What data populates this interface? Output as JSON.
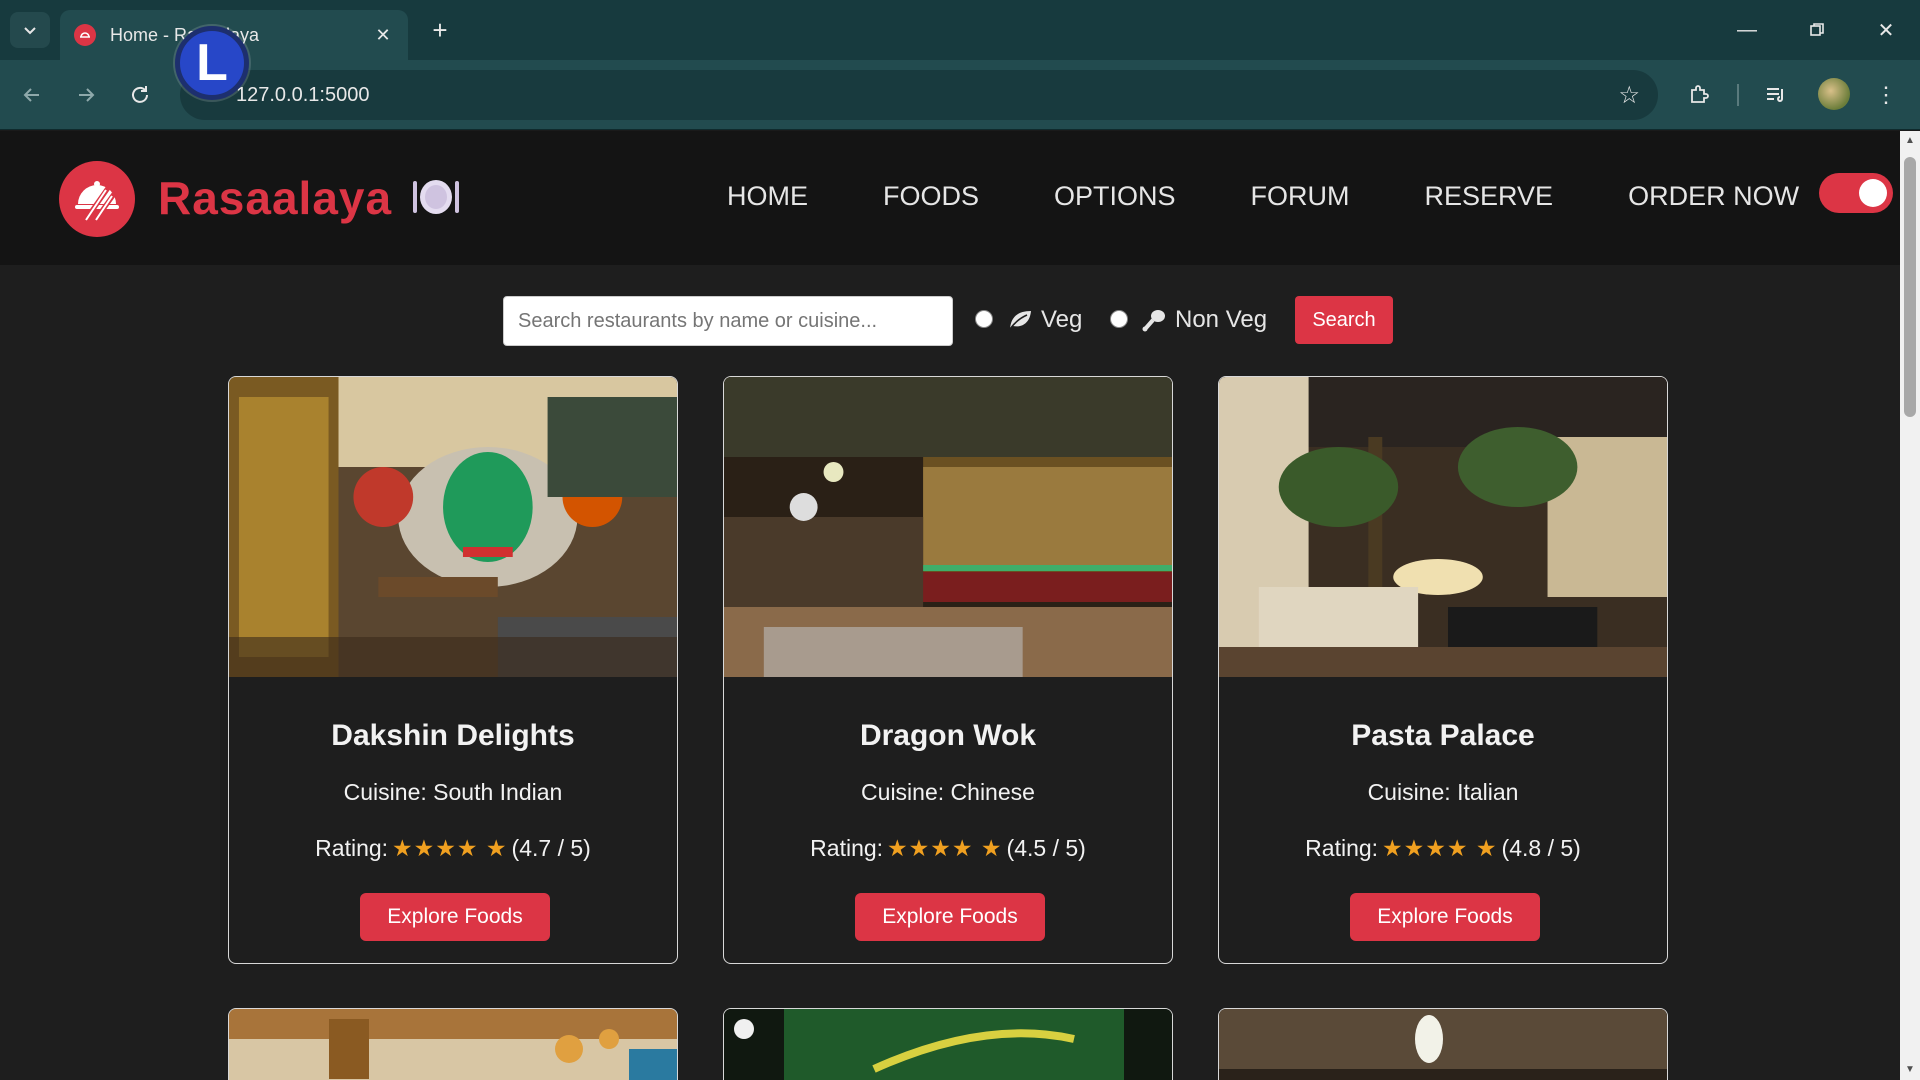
{
  "browser": {
    "tab_title": "Home - Rasaalaya",
    "url": "127.0.0.1:5000",
    "overlay_letter": "L"
  },
  "site": {
    "brand": "Rasaalaya",
    "nav": [
      "HOME",
      "FOODS",
      "OPTIONS",
      "FORUM",
      "RESERVE",
      "ORDER NOW"
    ],
    "dark_mode_toggle": "on",
    "accent_color": "#dc3545"
  },
  "search": {
    "placeholder": "Search restaurants by name or cuisine...",
    "veg_label": "Veg",
    "nonveg_label": "Non Veg",
    "button_label": "Search"
  },
  "restaurants": [
    {
      "name": "Dakshin Delights",
      "cuisine_prefix": "Cuisine:",
      "cuisine": "South Indian",
      "rating_prefix": "Rating:",
      "stars": "★★★★ ★",
      "rating_text": "(4.7 / 5)",
      "button": "Explore Foods"
    },
    {
      "name": "Dragon Wok",
      "cuisine_prefix": "Cuisine:",
      "cuisine": "Chinese",
      "rating_prefix": "Rating:",
      "stars": "★★★★ ★",
      "rating_text": "(4.5 / 5)",
      "button": "Explore Foods"
    },
    {
      "name": "Pasta Palace",
      "cuisine_prefix": "Cuisine:",
      "cuisine": "Italian",
      "rating_prefix": "Rating:",
      "stars": "★★★★ ★",
      "rating_text": "(4.8 / 5)",
      "button": "Explore Foods"
    }
  ]
}
